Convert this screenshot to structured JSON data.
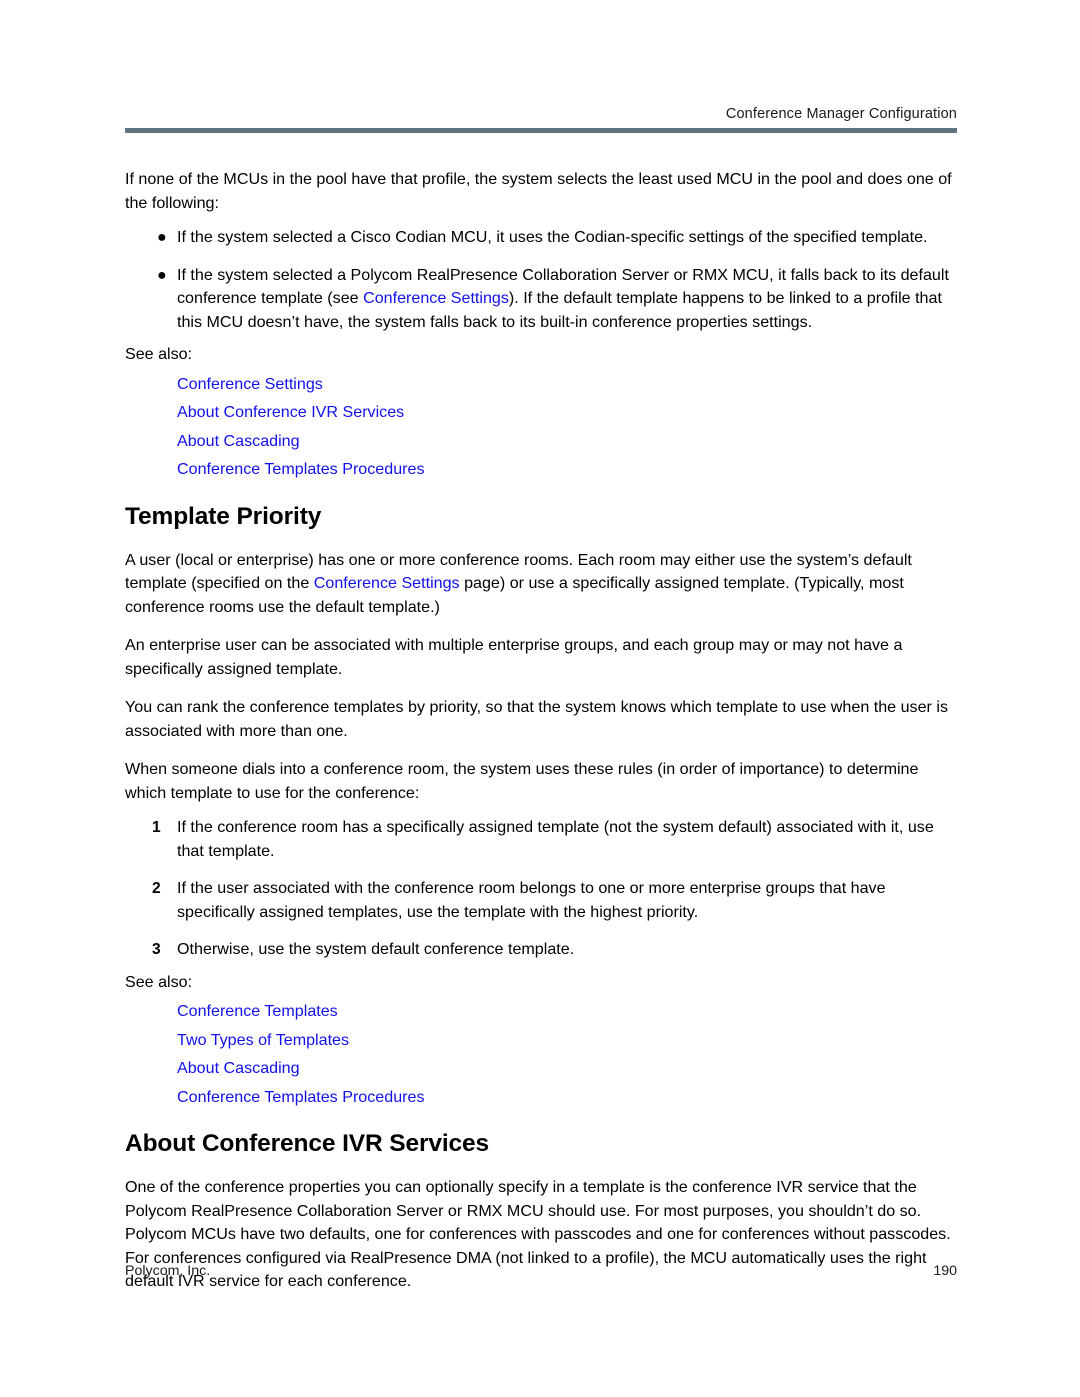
{
  "header": {
    "title": "Conference Manager Configuration",
    "rule_color": "#5f7480"
  },
  "link_color": "#1111ee",
  "intro": {
    "lead_before": "If none of the MCUs in the pool have that profile, the system selects the least used MCU in the pool and does one of the following:",
    "bullets": [
      {
        "glyph": "●",
        "text_before": "If the system selected a Cisco Codian MCU, it uses the Codian-specific settings of the specified template.",
        "link": "",
        "text_after": ""
      },
      {
        "glyph": "●",
        "text_before": "If the system selected a Polycom RealPresence Collaboration Server or RMX MCU, it falls back to its default conference template (see ",
        "link": "Conference Settings",
        "text_after": "). If the default template happens to be linked to a profile that this MCU doesn’t have, the system falls back to its built-in conference properties settings."
      }
    ],
    "see_also_label": "See also:",
    "see_also_links": [
      "Conference Settings",
      "About Conference IVR Services",
      "About Cascading",
      "Conference Templates Procedures"
    ]
  },
  "template_priority": {
    "heading": "Template Priority",
    "para1_before": "A user (local or enterprise) has one or more conference rooms. Each room may either use the system’s default template (specified on the ",
    "para1_link": "Conference Settings",
    "para1_after": " page) or use a specifically assigned template. (Typically, most conference rooms use the default template.)",
    "para2": "An enterprise user can be associated with multiple enterprise groups, and each group may or may not have a specifically assigned template.",
    "para3": "You can rank the conference templates by priority, so that the system knows which template to use when the user is associated with more than one.",
    "para4": "When someone dials into a conference room, the system uses these rules (in order of importance) to determine which template to use for the conference:",
    "steps": [
      {
        "number": "1",
        "text": "If the conference room has a specifically assigned template (not the system default) associated with it, use that template."
      },
      {
        "number": "2",
        "text": "If the user associated with the conference room belongs to one or more enterprise groups that have specifically assigned templates, use the template with the highest priority."
      },
      {
        "number": "3",
        "text": "Otherwise, use the system default conference template."
      }
    ],
    "see_also_label": "See also:",
    "see_also_links": [
      "Conference Templates",
      "Two Types of Templates",
      "About Cascading",
      "Conference Templates Procedures"
    ]
  },
  "ivr_services": {
    "heading": "About Conference IVR Services",
    "paragraph": "One of the conference properties you can optionally specify in a template is the conference IVR service that the Polycom RealPresence Collaboration Server or RMX MCU should use. For most purposes, you shouldn’t do so. Polycom MCUs have two defaults, one for conferences with passcodes and one for conferences without passcodes. For conferences configured via RealPresence DMA (not linked to a profile), the MCU automatically uses the right default IVR service for each conference."
  },
  "footer": {
    "company": "Polycom, Inc.",
    "page_number": "190"
  }
}
